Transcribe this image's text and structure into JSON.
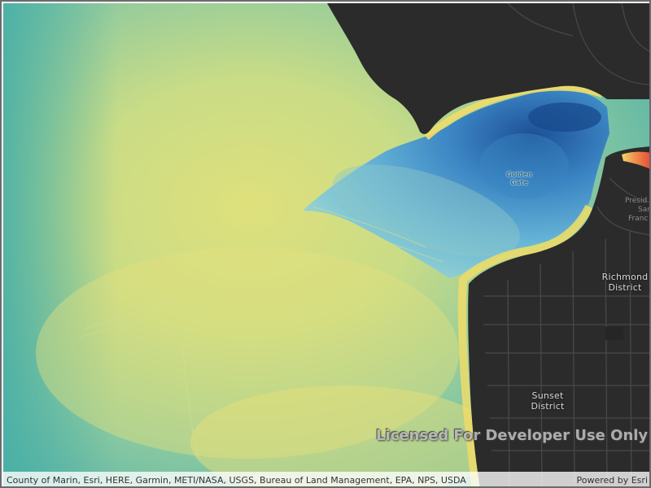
{
  "map": {
    "labels": {
      "golden_gate": [
        "Golden",
        "Gate"
      ],
      "presidio": [
        "Presid",
        "San",
        "Franc"
      ],
      "richmond": [
        "Richmond",
        "District"
      ],
      "sunset": [
        "Sunset",
        "District"
      ]
    },
    "watermark": "Licensed For Developer Use Only",
    "attribution": "County of Marin, Esri, HERE, Garmin, METI/NASA, USGS, Bureau of Land Management, EPA, NPS, USDA",
    "powered_by": "Powered by Esri",
    "colors": {
      "land": "#2a2a2a",
      "roads": "#4a4a4a",
      "shallow_water": "#e6e07a",
      "mid_water": "#7fc8a6",
      "deep_water": "#1e5aa0"
    }
  }
}
